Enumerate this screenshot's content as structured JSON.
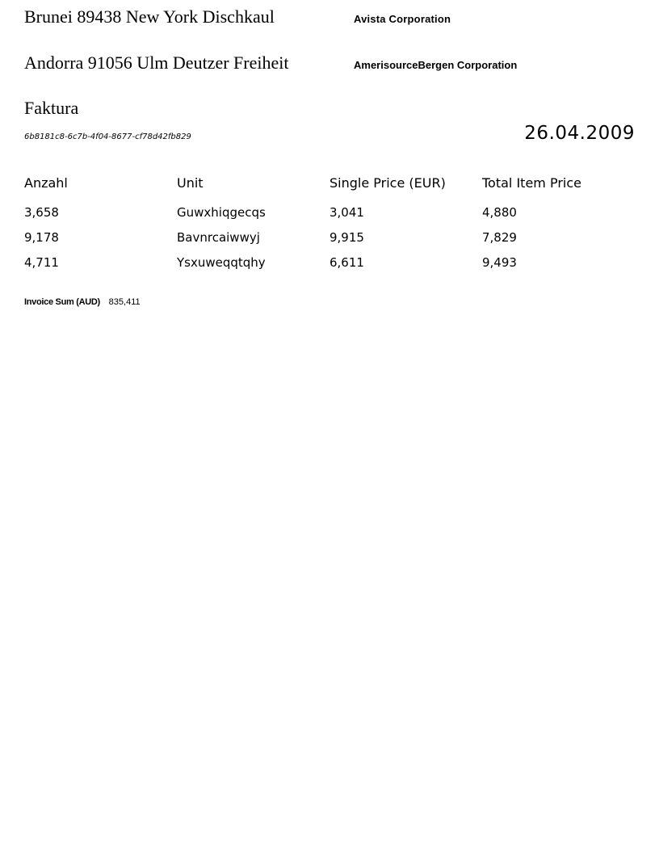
{
  "sender": {
    "address": "Brunei 89438 New York Dischkaul",
    "company": "Avista Corporation"
  },
  "recipient": {
    "address": "Andorra 91056 Ulm Deutzer Freiheit",
    "company": "AmerisourceBergen Corporation"
  },
  "document": {
    "title": "Faktura",
    "id": "6b8181c8-6c7b-4f04-8677-cf78d42fb829",
    "date": "26.04.2009"
  },
  "table": {
    "headers": [
      "Anzahl",
      "Unit",
      "Single Price (EUR)",
      "Total Item Price"
    ],
    "rows": [
      [
        "3,658",
        "Guwxhiqgecqs",
        "3,041",
        "4,880"
      ],
      [
        "9,178",
        "Bavnrcaiwwyj",
        "9,915",
        "7,829"
      ],
      [
        "4,711",
        "Ysxuweqqtqhy",
        "6,611",
        "9,493"
      ]
    ]
  },
  "summary": {
    "label": "Invoice Sum (AUD)",
    "value": "835,411"
  }
}
